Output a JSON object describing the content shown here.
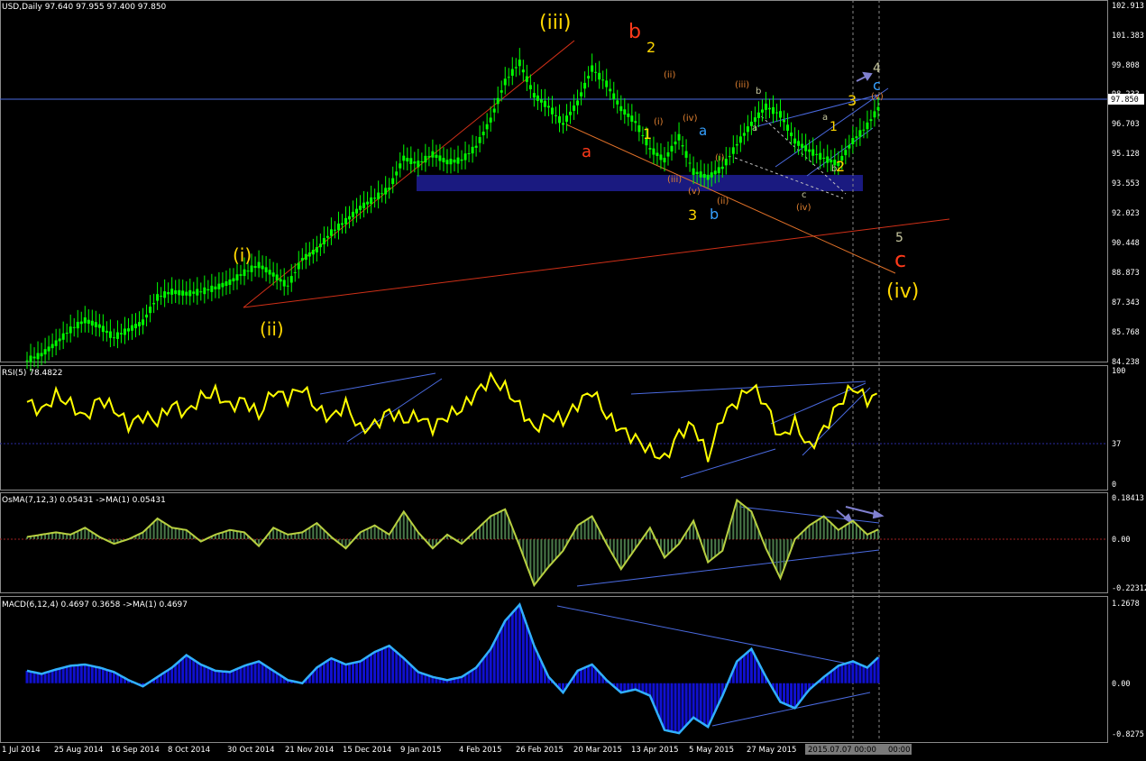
{
  "header": {
    "main": "USD,Daily  97.640 97.955 97.400 97.850",
    "rsi": "RSI(5) 78.4822",
    "osma": "OsMA(7,12,3) 0.05431  ->MA(1) 0.05431",
    "macd": "MACD(6,12,4) 0.4697 0.3658  ->MA(1) 0.4697"
  },
  "price_axis": {
    "ticks": [
      "102.913",
      "101.383",
      "99.808",
      "98.233",
      "96.703",
      "95.128",
      "93.553",
      "92.023",
      "90.448",
      "88.873",
      "87.343",
      "85.768",
      "84.238"
    ],
    "current": "97.850"
  },
  "rsi_axis": {
    "ticks": [
      "100",
      "37",
      "0"
    ]
  },
  "osma_axis": {
    "ticks": [
      "0.18413",
      "0.00",
      "-0.22312"
    ]
  },
  "macd_axis": {
    "ticks": [
      "1.2678",
      "0.00",
      "-0.8275"
    ]
  },
  "time_axis": {
    "labels": [
      "1 Jul 2014",
      "25 Aug 2014",
      "16 Sep 2014",
      "8 Oct 2014",
      "30 Oct 2014",
      "21 Nov 2014",
      "15 Dec 2014",
      "9 Jan 2015",
      "4 Feb 2015",
      "26 Feb 2015",
      "20 Mar 2015",
      "13 Apr 2015",
      "5 May 2015",
      "27 May 2015",
      "18"
    ],
    "cursor_label": "2015.07.07 00:00",
    "cursor_label2": "00:00"
  },
  "wave_labels": [
    {
      "text": "(iii)",
      "color": "#ffd700",
      "size": 22
    },
    {
      "text": "b",
      "color": "#ff3a1a",
      "size": 22
    },
    {
      "text": "a",
      "color": "#ff3a1a",
      "size": 18
    },
    {
      "text": "(i)",
      "color": "#ffd700",
      "size": 20
    },
    {
      "text": "(ii)",
      "color": "#ffd700",
      "size": 20
    },
    {
      "text": "(iv)",
      "color": "#ffd700",
      "size": 22
    },
    {
      "text": "c",
      "color": "#ff3a1a",
      "size": 24
    },
    {
      "text": "5",
      "color": "#c8c8a0",
      "size": 14
    },
    {
      "text": "4",
      "color": "#c8c8a0",
      "size": 14
    },
    {
      "text": "c",
      "color": "#35a0ff",
      "size": 16
    },
    {
      "text": "a",
      "color": "#35a0ff",
      "size": 15
    },
    {
      "text": "b",
      "color": "#35a0ff",
      "size": 16
    },
    {
      "text": "3",
      "color": "#ffd700",
      "size": 16
    },
    {
      "text": "2",
      "color": "#ffd700",
      "size": 16
    },
    {
      "text": "1",
      "color": "#ffd700",
      "size": 16
    },
    {
      "text": "3",
      "color": "#ffd700",
      "size": 16
    },
    {
      "text": "1",
      "color": "#ffd700",
      "size": 14
    },
    {
      "text": "2",
      "color": "#ffd700",
      "size": 16
    },
    {
      "text": "(ii)",
      "color": "#e08030",
      "size": 10
    },
    {
      "text": "(i)",
      "color": "#e08030",
      "size": 10
    },
    {
      "text": "(iv)",
      "color": "#e08030",
      "size": 10
    },
    {
      "text": "(i)",
      "color": "#e08030",
      "size": 10
    },
    {
      "text": "(iii)",
      "color": "#e08030",
      "size": 10
    },
    {
      "text": "(v)",
      "color": "#e08030",
      "size": 10
    },
    {
      "text": "(ii)",
      "color": "#e08030",
      "size": 10
    },
    {
      "text": "(iii)",
      "color": "#e08030",
      "size": 10
    },
    {
      "text": "b",
      "color": "#c8c8a0",
      "size": 10
    },
    {
      "text": "a",
      "color": "#c8c8a0",
      "size": 10
    },
    {
      "text": "c",
      "color": "#c8c8a0",
      "size": 10
    },
    {
      "text": "(iv)",
      "color": "#e08030",
      "size": 10
    },
    {
      "text": "a",
      "color": "#c8c8a0",
      "size": 10
    },
    {
      "text": "b",
      "color": "#c8c8a0",
      "size": 10
    },
    {
      "text": "(v)",
      "color": "#e08030",
      "size": 10
    }
  ],
  "chart_data": [
    {
      "type": "line",
      "title": "USD,Daily",
      "series": [
        {
          "values": [
            84.3,
            84.6,
            85.2,
            85.9,
            86.4,
            86.1,
            85.5,
            85.9,
            86.3,
            87.6,
            87.9,
            87.8,
            87.9,
            88.1,
            88.4,
            88.9,
            89.3,
            88.8,
            88.2,
            89.6,
            90.1,
            91.0,
            91.6,
            92.3,
            92.8,
            93.3,
            94.9,
            94.6,
            95.1,
            94.7,
            94.8,
            95.5,
            96.9,
            98.9,
            99.9,
            98.2,
            97.6,
            96.7,
            97.8,
            99.6,
            98.8,
            97.5,
            96.8,
            95.4,
            94.8,
            96.0,
            94.2,
            93.9,
            94.4,
            95.6,
            96.7,
            97.6,
            97.2,
            95.8,
            95.3,
            94.9,
            94.6,
            95.8,
            96.6,
            97.8
          ]
        }
      ],
      "ylim": [
        84.238,
        102.913
      ],
      "note_colors": {
        "candles": "#00ff00",
        "support_zone": "#1a1a80"
      }
    },
    {
      "type": "line",
      "title": "RSI(5)",
      "series": [
        {
          "name": "RSI(5)",
          "values": [
            72,
            64,
            78,
            70,
            58,
            75,
            66,
            52,
            60,
            55,
            70,
            62,
            76,
            80,
            68,
            74,
            60,
            82,
            75,
            85,
            66,
            58,
            70,
            48,
            52,
            64,
            56,
            60,
            50,
            60,
            66,
            80,
            92,
            84,
            68,
            48,
            60,
            56,
            70,
            82,
            60,
            48,
            40,
            30,
            22,
            45,
            52,
            24,
            60,
            72,
            86,
            70,
            40,
            54,
            32,
            48,
            70,
            85,
            74,
            78
          ]
        }
      ],
      "ylim": [
        0,
        100
      ],
      "levels": [
        37
      ]
    },
    {
      "type": "area",
      "title": "OsMA(7,12,3)",
      "series": [
        {
          "name": "OsMA",
          "values": [
            0.01,
            0.02,
            0.03,
            0.02,
            0.05,
            0.01,
            -0.02,
            0.0,
            0.03,
            0.09,
            0.05,
            0.04,
            -0.01,
            0.02,
            0.04,
            0.03,
            -0.03,
            0.05,
            0.02,
            0.03,
            0.07,
            0.01,
            -0.04,
            0.03,
            0.06,
            0.02,
            0.12,
            0.03,
            -0.04,
            0.02,
            -0.02,
            0.04,
            0.1,
            0.13,
            -0.03,
            -0.2,
            -0.12,
            -0.05,
            0.06,
            0.1,
            -0.02,
            -0.13,
            -0.04,
            0.05,
            -0.08,
            -0.02,
            0.08,
            -0.1,
            -0.05,
            0.17,
            0.12,
            -0.04,
            -0.17,
            0.0,
            0.06,
            0.1,
            0.04,
            0.08,
            0.02,
            0.05
          ]
        }
      ],
      "ylim": [
        -0.22312,
        0.18413
      ]
    },
    {
      "type": "area",
      "title": "MACD(6,12,4)",
      "series": [
        {
          "name": "MACD",
          "values": [
            0.2,
            0.15,
            0.22,
            0.28,
            0.3,
            0.25,
            0.18,
            0.05,
            -0.05,
            0.1,
            0.25,
            0.45,
            0.3,
            0.2,
            0.18,
            0.28,
            0.35,
            0.2,
            0.05,
            0.0,
            0.25,
            0.4,
            0.3,
            0.35,
            0.5,
            0.6,
            0.4,
            0.18,
            0.1,
            0.05,
            0.1,
            0.25,
            0.55,
            1.0,
            1.26,
            0.6,
            0.1,
            -0.15,
            0.2,
            0.3,
            0.05,
            -0.15,
            -0.1,
            -0.2,
            -0.75,
            -0.8,
            -0.55,
            -0.7,
            -0.2,
            0.35,
            0.55,
            0.1,
            -0.3,
            -0.4,
            -0.1,
            0.1,
            0.28,
            0.35,
            0.25,
            0.47
          ]
        }
      ],
      "ylim": [
        -0.8275,
        1.2678
      ]
    }
  ]
}
